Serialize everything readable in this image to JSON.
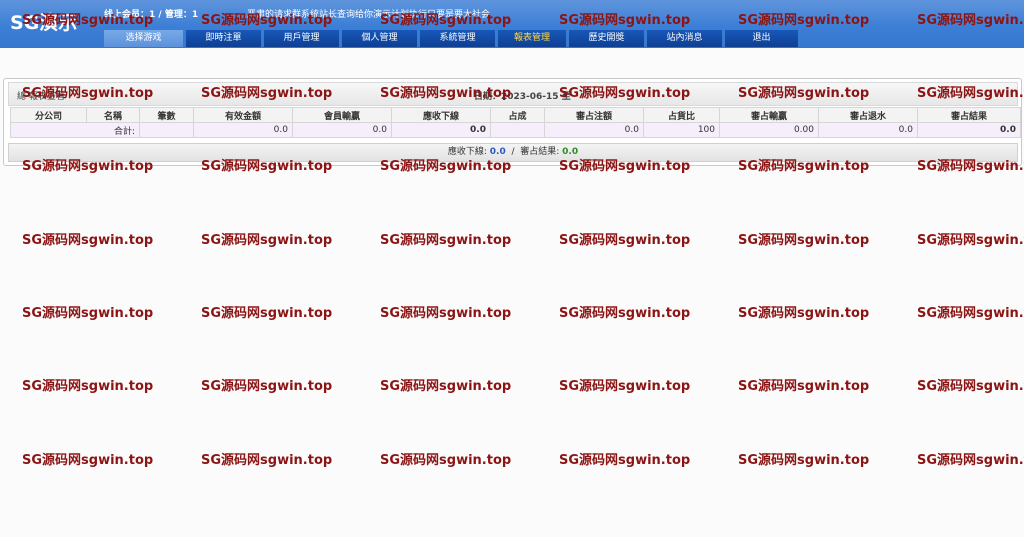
{
  "header": {
    "logo": "SG演示",
    "online_text": "线上会员：1 / 管理：1",
    "notice": "严肃的请求群系统站长查询给你演示计划执行只要是要大社会"
  },
  "nav": {
    "items": [
      {
        "label": "选择游戏"
      },
      {
        "label": "即時注單"
      },
      {
        "label": "用戶管理"
      },
      {
        "label": "個人管理"
      },
      {
        "label": "系統管理"
      },
      {
        "label": "報表管理"
      },
      {
        "label": "歷史開獎"
      },
      {
        "label": "站內消息"
      },
      {
        "label": "退出"
      }
    ]
  },
  "report": {
    "title": "總 報表查看",
    "date_range": "日期：2023-06-15 至",
    "columns": [
      "分公司",
      "名稱",
      "筆數",
      "有效金額",
      "會員輸贏",
      "應收下線",
      "占成",
      "審占注額",
      "占貨比",
      "審占輸贏",
      "審占退水",
      "審占結果"
    ],
    "total_row": {
      "label": "合計:",
      "count": "",
      "valid_amount": "0.0",
      "member_winloss": "0.0",
      "receivable": "0.0",
      "share": "",
      "share_bet": "0.0",
      "share_ratio": "100",
      "share_winloss": "0.00",
      "share_rebate": "0.0",
      "share_result": "0.0"
    },
    "summary": {
      "receivable_label": "應收下線:",
      "receivable_value": "0.0",
      "separator": "/",
      "result_label": "審占結果:",
      "result_value": "0.0"
    }
  },
  "watermark": {
    "text": "SG源码网sgwin.top"
  },
  "colors": {
    "header_bg": "#3c7fd6",
    "nav_bg": "#1353ad",
    "nav_active_text": "#ffd84a",
    "watermark": "#8b1414",
    "value_green": "#2e8b22",
    "value_blue": "#2b59c3"
  }
}
